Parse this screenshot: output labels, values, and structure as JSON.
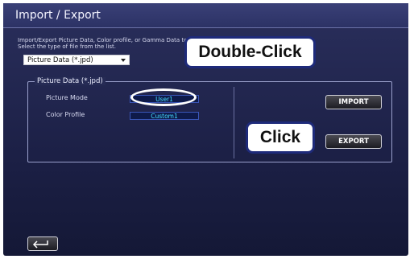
{
  "window": {
    "title": "Import / Export"
  },
  "description": {
    "line1": "Import/Export Picture Data, Color profile, or Gamma Data to/from the projector.",
    "line2": "Select the type of file from the list."
  },
  "file_type_select": {
    "value": "Picture Data (*.jpd)"
  },
  "panel": {
    "legend": "Picture Data (*.jpd)",
    "rows": [
      {
        "label": "Picture Mode",
        "value": "User1"
      },
      {
        "label": "Color Profile",
        "value": "Custom1"
      }
    ]
  },
  "buttons": {
    "import": "IMPORT",
    "export": "EXPORT"
  },
  "annotations": {
    "double_click": "Double-Click",
    "click": "Click"
  },
  "icons": {
    "back": "return-arrow-icon"
  },
  "colors": {
    "accent_value_text": "#46e0ff",
    "callout_border": "#1e2a7a",
    "background": "#1c2046"
  }
}
